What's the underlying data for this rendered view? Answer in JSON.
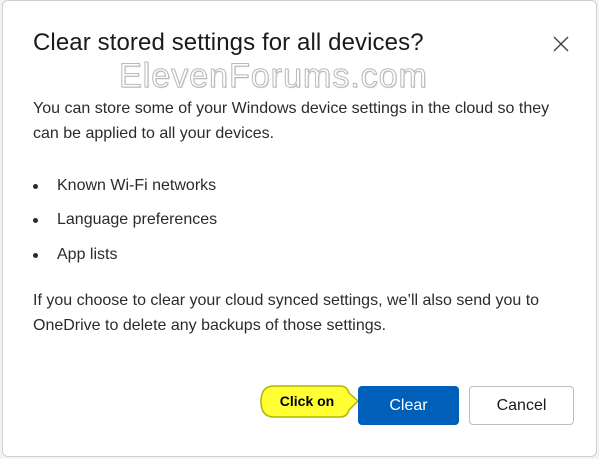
{
  "dialog": {
    "title": "Clear stored settings for all devices?",
    "description": "You can store some of your Windows device settings in the cloud so they can be applied to all your devices.",
    "list": [
      {
        "label": "Known Wi-Fi networks"
      },
      {
        "label": "Language preferences"
      },
      {
        "label": "App lists"
      }
    ],
    "note": "If you choose to clear your cloud synced settings, we’ll also send you to OneDrive to delete any backups of those settings.",
    "buttons": {
      "primary": "Clear",
      "secondary": "Cancel"
    },
    "close_icon": "close-icon"
  },
  "watermark": "ElevenForums.com",
  "annotation": {
    "callout_text": "Click on",
    "callout_color": "#ffff33"
  },
  "colors": {
    "accent": "#005fb8",
    "callout_border": "#b3b300"
  }
}
